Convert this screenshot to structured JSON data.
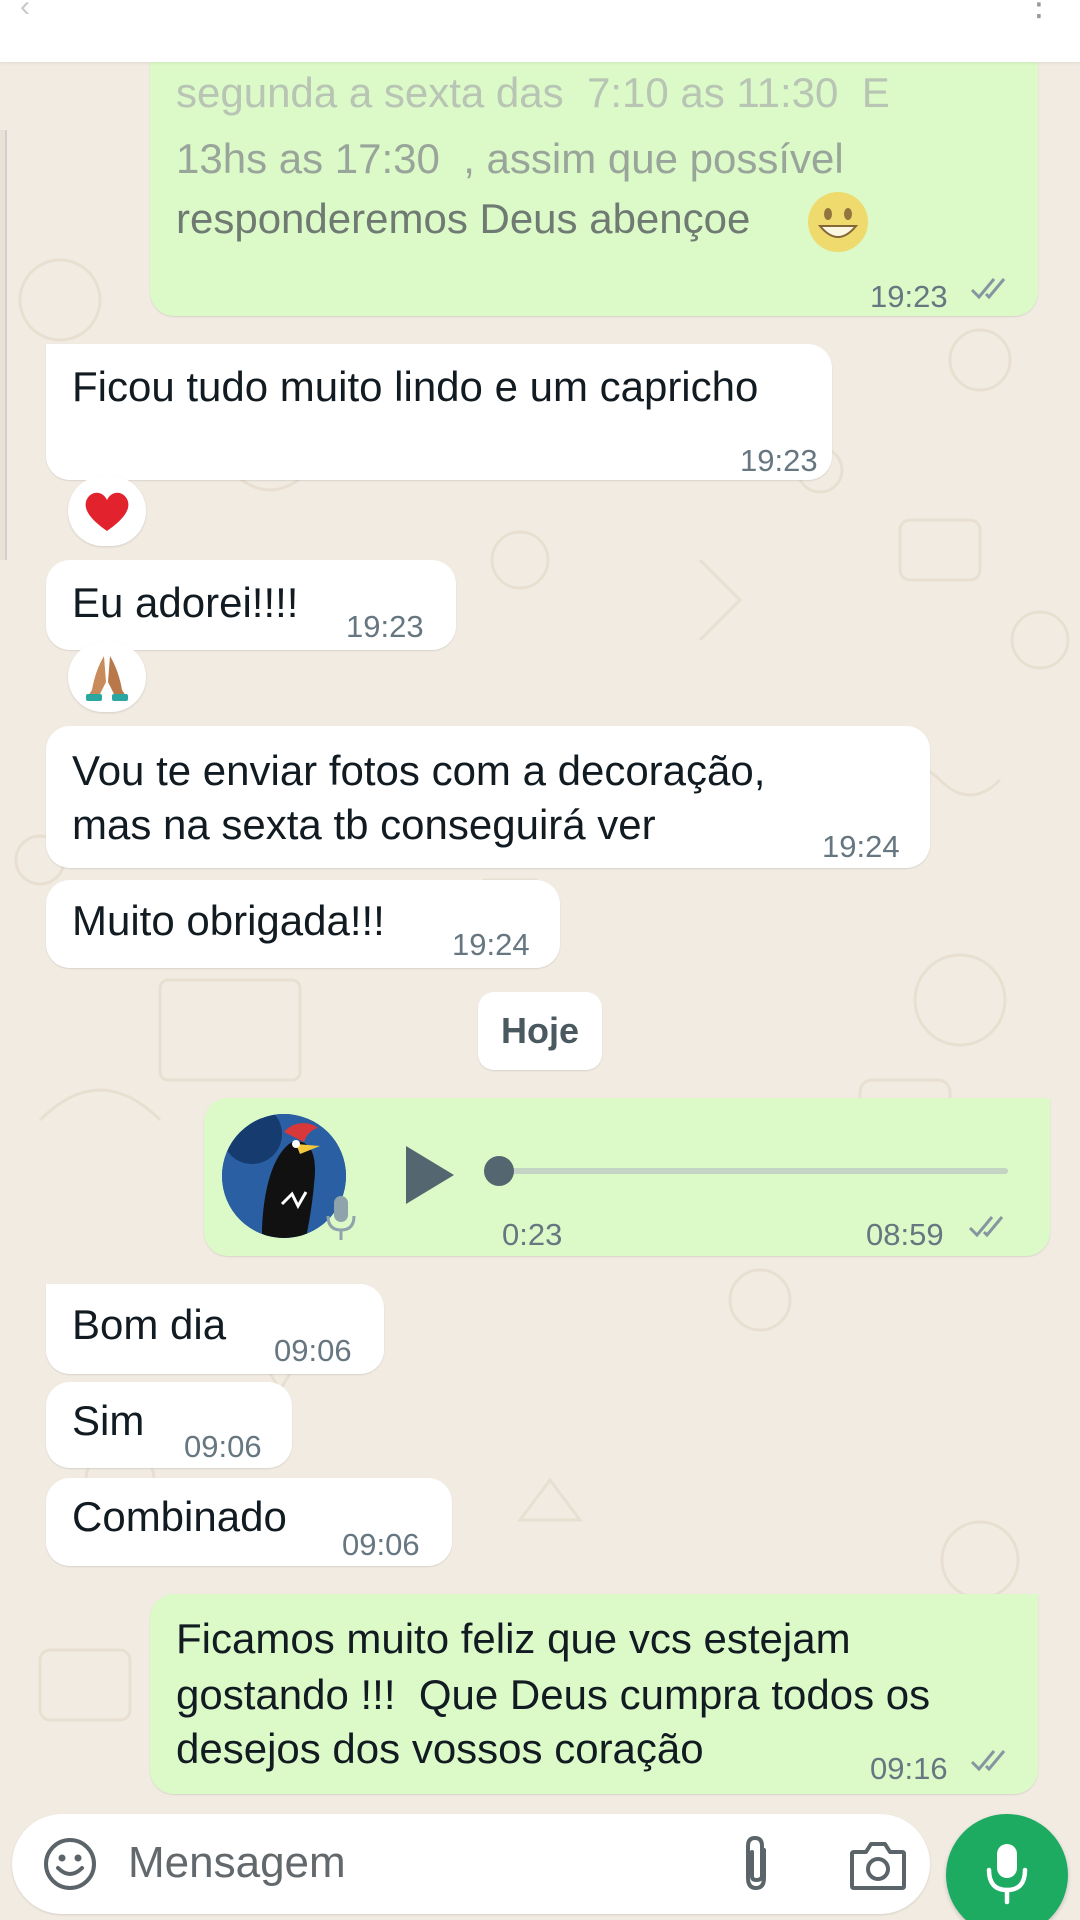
{
  "header": {
    "back_icon": "arrow-left-icon",
    "menu_icon": "more-vertical-icon"
  },
  "messages": [
    {
      "direction": "outgoing",
      "lines": [
        "segunda a sexta das  7:10 as 11:30  E",
        "13hs as 17:30  , assim que possível",
        "responderemos Deus abençoe"
      ],
      "emoji": "grinning-face",
      "time": "19:23",
      "status": "read"
    },
    {
      "direction": "incoming",
      "lines": [
        "Ficou tudo muito lindo e um capricho"
      ],
      "time": "19:23",
      "reaction": "red-heart"
    },
    {
      "direction": "incoming",
      "lines": [
        "Eu adorei!!!!"
      ],
      "time": "19:23",
      "reaction": "folded-hands"
    },
    {
      "direction": "incoming",
      "lines": [
        "Vou te enviar fotos com a decoração,",
        "mas na sexta tb conseguirá ver"
      ],
      "time": "19:24"
    },
    {
      "direction": "incoming",
      "lines": [
        "Muito obrigada!!!"
      ],
      "time": "19:24"
    }
  ],
  "day_divider": "Hoje",
  "voice_note": {
    "direction": "outgoing",
    "duration": "0:23",
    "time": "08:59",
    "status": "read",
    "progress": 0,
    "avatar_icon": "contact-avatar-bird",
    "play_icon": "play-icon",
    "mic_badge_icon": "microphone-icon"
  },
  "messages_today": [
    {
      "direction": "incoming",
      "lines": [
        "Bom dia"
      ],
      "time": "09:06"
    },
    {
      "direction": "incoming",
      "lines": [
        "Sim"
      ],
      "time": "09:06"
    },
    {
      "direction": "incoming",
      "lines": [
        "Combinado"
      ],
      "time": "09:06"
    },
    {
      "direction": "outgoing",
      "lines": [
        "Ficamos muito feliz que vcs estejam",
        "gostando !!!  Que Deus cumpra todos os",
        "desejos dos vossos coração"
      ],
      "time": "09:16",
      "status": "read"
    }
  ],
  "composer": {
    "placeholder": "Mensagem",
    "emoji_icon": "emoji-icon",
    "attach_icon": "paperclip-icon",
    "camera_icon": "camera-icon",
    "send_icon": "microphone-icon"
  },
  "colors": {
    "chat_background": "#f1ebe2",
    "incoming_bubble": "#ffffff",
    "outgoing_bubble": "#dcf9c8",
    "timestamp": "#667781",
    "read_ticks": "#8696a0",
    "accent_green": "#1daa61"
  }
}
